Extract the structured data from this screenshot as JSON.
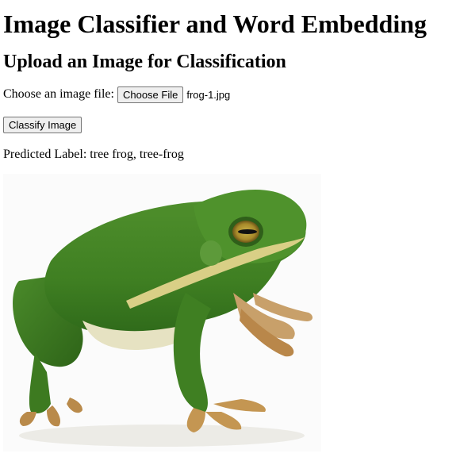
{
  "page": {
    "title": "Image Classifier and Word Embedding",
    "subtitle": "Upload an Image for Classification"
  },
  "upload": {
    "label": "Choose an image file:",
    "choose_button": "Choose File",
    "file_name": "frog-1.jpg"
  },
  "classify": {
    "button_label": "Classify Image"
  },
  "prediction": {
    "text": "Predicted Label: tree frog, tree-frog"
  },
  "image": {
    "subject": "green tree frog"
  }
}
